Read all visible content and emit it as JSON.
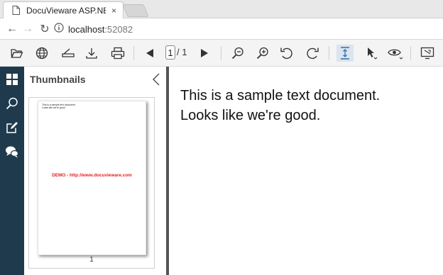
{
  "browser": {
    "tab_title": "DocuVieware ASP.NET Co",
    "tab_close": "×",
    "url_host": "localhost",
    "url_port": ":52082",
    "back_glyph": "←",
    "forward_glyph": "→",
    "reload_glyph": "↻"
  },
  "toolbar": {
    "page_current": "1",
    "page_total": "/ 1",
    "icons": [
      "open-icon",
      "globe-icon",
      "scanner-icon",
      "download-icon",
      "print-icon",
      "previous-page-icon",
      "next-page-icon",
      "zoom-out-icon",
      "zoom-in-icon",
      "rotate-left-icon",
      "rotate-right-icon",
      "fit-page-icon",
      "pointer-icon",
      "view-icon",
      "fullscreen-icon"
    ],
    "accent": "#dbe4ef"
  },
  "sidebar": {
    "background": "#1f3a4d",
    "items": [
      "thumbnails-icon",
      "search-icon",
      "annotate-icon",
      "comments-icon"
    ]
  },
  "thumbnails": {
    "title": "Thumbnails",
    "page_line1": "This is a sample text document.",
    "page_line2": "Looks like we're good.",
    "watermark": "DEMO - http://www.docuvieware.com",
    "page_number": "1"
  },
  "document": {
    "line1": "This is a sample text document.",
    "line2": "Looks like we're good."
  }
}
